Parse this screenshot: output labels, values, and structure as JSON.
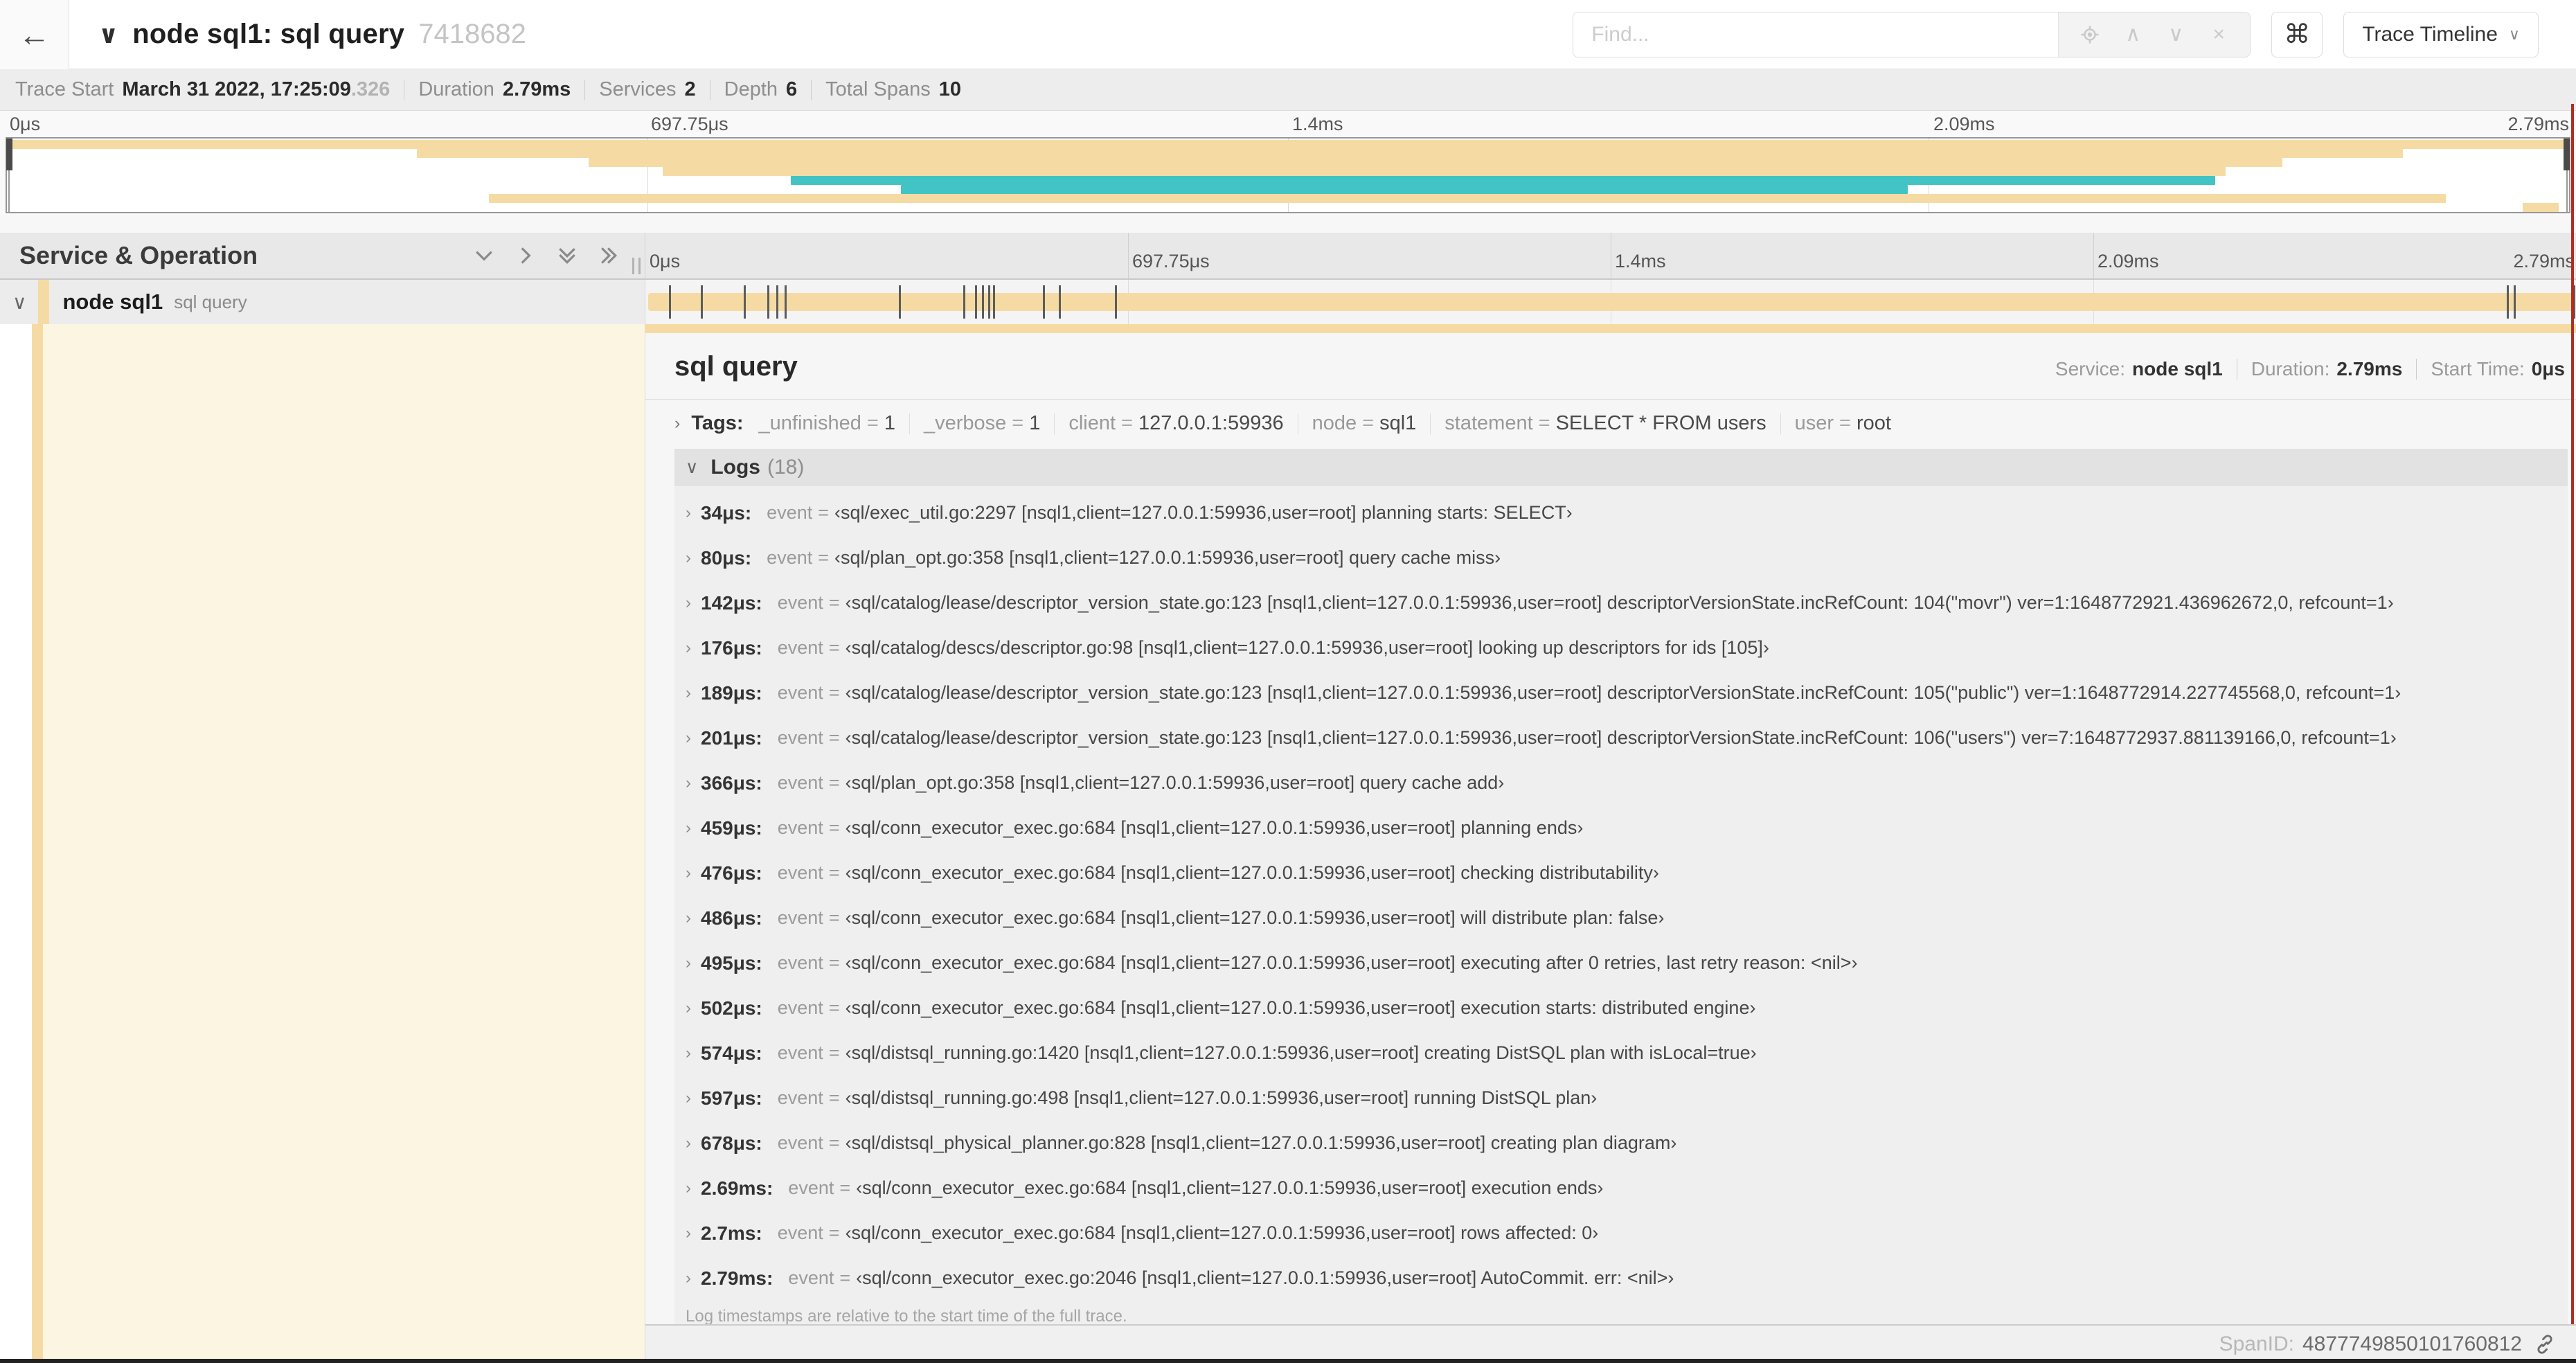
{
  "header": {
    "back_icon": "←",
    "title": "node sql1: sql query",
    "trace_id": "7418682",
    "find_placeholder": "Find...",
    "shortcut_key": "⌘",
    "view_select": "Trace Timeline"
  },
  "trace_info": {
    "items": [
      {
        "label": "Trace Start",
        "value": "March 31 2022, 17:25:09",
        "suffix": ".326"
      },
      {
        "label": "Duration",
        "value": "2.79ms"
      },
      {
        "label": "Services",
        "value": "2"
      },
      {
        "label": "Depth",
        "value": "6"
      },
      {
        "label": "Total Spans",
        "value": "10"
      }
    ]
  },
  "timeline": {
    "ticks": [
      "0μs",
      "697.75μs",
      "1.4ms",
      "2.09ms",
      "2.79ms"
    ],
    "duration_us": 2790,
    "colors": {
      "tan": "#f5dba3",
      "teal": "#41c4c3",
      "cursor_red": "#af2e23"
    },
    "minimap_bars": [
      {
        "row": 0,
        "start": 0.2,
        "end": 99.8,
        "color": "tan"
      },
      {
        "row": 1,
        "start": 16.0,
        "end": 93.5,
        "color": "tan"
      },
      {
        "row": 2,
        "start": 22.7,
        "end": 88.8,
        "color": "tan"
      },
      {
        "row": 3,
        "start": 25.6,
        "end": 86.6,
        "color": "tan"
      },
      {
        "row": 4,
        "start": 30.6,
        "end": 86.2,
        "color": "teal"
      },
      {
        "row": 5,
        "start": 34.9,
        "end": 74.2,
        "color": "teal"
      },
      {
        "row": 6,
        "start": 18.8,
        "end": 95.2,
        "color": "tan"
      },
      {
        "row": 7,
        "start": 98.2,
        "end": 99.6,
        "color": "tan"
      }
    ]
  },
  "left_panel": {
    "header": "Service & Operation",
    "row": {
      "service": "node sql1",
      "operation": "sql query"
    }
  },
  "detail": {
    "title": "sql query",
    "summary": [
      {
        "label": "Service:",
        "value": "node sql1"
      },
      {
        "label": "Duration:",
        "value": "2.79ms"
      },
      {
        "label": "Start Time:",
        "value": "0μs"
      }
    ],
    "tags_label": "Tags:",
    "tags": [
      {
        "key": "_unfinished",
        "value": "1"
      },
      {
        "key": "_verbose",
        "value": "1"
      },
      {
        "key": "client",
        "value": "127.0.0.1:59936"
      },
      {
        "key": "node",
        "value": "sql1"
      },
      {
        "key": "statement",
        "value": "SELECT * FROM users"
      },
      {
        "key": "user",
        "value": "root"
      }
    ],
    "logs_label": "Logs",
    "logs_count": "(18)",
    "logs": [
      {
        "time": "34μs",
        "key": "event",
        "value": "‹sql/exec_util.go:2297 [nsql1,client=127.0.0.1:59936,user=root] planning starts: SELECT›"
      },
      {
        "time": "80μs",
        "key": "event",
        "value": "‹sql/plan_opt.go:358 [nsql1,client=127.0.0.1:59936,user=root] query cache miss›"
      },
      {
        "time": "142μs",
        "key": "event",
        "value": "‹sql/catalog/lease/descriptor_version_state.go:123 [nsql1,client=127.0.0.1:59936,user=root] descriptorVersionState.incRefCount: 104(\"movr\") ver=1:1648772921.436962672,0, refcount=1›"
      },
      {
        "time": "176μs",
        "key": "event",
        "value": "‹sql/catalog/descs/descriptor.go:98 [nsql1,client=127.0.0.1:59936,user=root] looking up descriptors for ids [105]›"
      },
      {
        "time": "189μs",
        "key": "event",
        "value": "‹sql/catalog/lease/descriptor_version_state.go:123 [nsql1,client=127.0.0.1:59936,user=root] descriptorVersionState.incRefCount: 105(\"public\") ver=1:1648772914.227745568,0, refcount=1›"
      },
      {
        "time": "201μs",
        "key": "event",
        "value": "‹sql/catalog/lease/descriptor_version_state.go:123 [nsql1,client=127.0.0.1:59936,user=root] descriptorVersionState.incRefCount: 106(\"users\") ver=7:1648772937.881139166,0, refcount=1›"
      },
      {
        "time": "366μs",
        "key": "event",
        "value": "‹sql/plan_opt.go:358 [nsql1,client=127.0.0.1:59936,user=root] query cache add›"
      },
      {
        "time": "459μs",
        "key": "event",
        "value": "‹sql/conn_executor_exec.go:684 [nsql1,client=127.0.0.1:59936,user=root] planning ends›"
      },
      {
        "time": "476μs",
        "key": "event",
        "value": "‹sql/conn_executor_exec.go:684 [nsql1,client=127.0.0.1:59936,user=root] checking distributability›"
      },
      {
        "time": "486μs",
        "key": "event",
        "value": "‹sql/conn_executor_exec.go:684 [nsql1,client=127.0.0.1:59936,user=root] will distribute plan: false›"
      },
      {
        "time": "495μs",
        "key": "event",
        "value": "‹sql/conn_executor_exec.go:684 [nsql1,client=127.0.0.1:59936,user=root] executing after 0 retries, last retry reason: <nil>›"
      },
      {
        "time": "502μs",
        "key": "event",
        "value": "‹sql/conn_executor_exec.go:684 [nsql1,client=127.0.0.1:59936,user=root] execution starts: distributed engine›"
      },
      {
        "time": "574μs",
        "key": "event",
        "value": "‹sql/distsql_running.go:1420 [nsql1,client=127.0.0.1:59936,user=root] creating DistSQL plan with isLocal=true›"
      },
      {
        "time": "597μs",
        "key": "event",
        "value": "‹sql/distsql_running.go:498 [nsql1,client=127.0.0.1:59936,user=root] running DistSQL plan›"
      },
      {
        "time": "678μs",
        "key": "event",
        "value": "‹sql/distsql_physical_planner.go:828 [nsql1,client=127.0.0.1:59936,user=root] creating plan diagram›"
      },
      {
        "time": "2.69ms",
        "key": "event",
        "value": "‹sql/conn_executor_exec.go:684 [nsql1,client=127.0.0.1:59936,user=root] execution ends›"
      },
      {
        "time": "2.7ms",
        "key": "event",
        "value": "‹sql/conn_executor_exec.go:684 [nsql1,client=127.0.0.1:59936,user=root] rows affected: 0›"
      },
      {
        "time": "2.79ms",
        "key": "event",
        "value": "‹sql/conn_executor_exec.go:2046 [nsql1,client=127.0.0.1:59936,user=root] AutoCommit. err: <nil>›"
      }
    ],
    "footer_note": "Log timestamps are relative to the start time of the full trace.",
    "span_id_label": "SpanID:",
    "span_id": "4877749850101760812"
  }
}
